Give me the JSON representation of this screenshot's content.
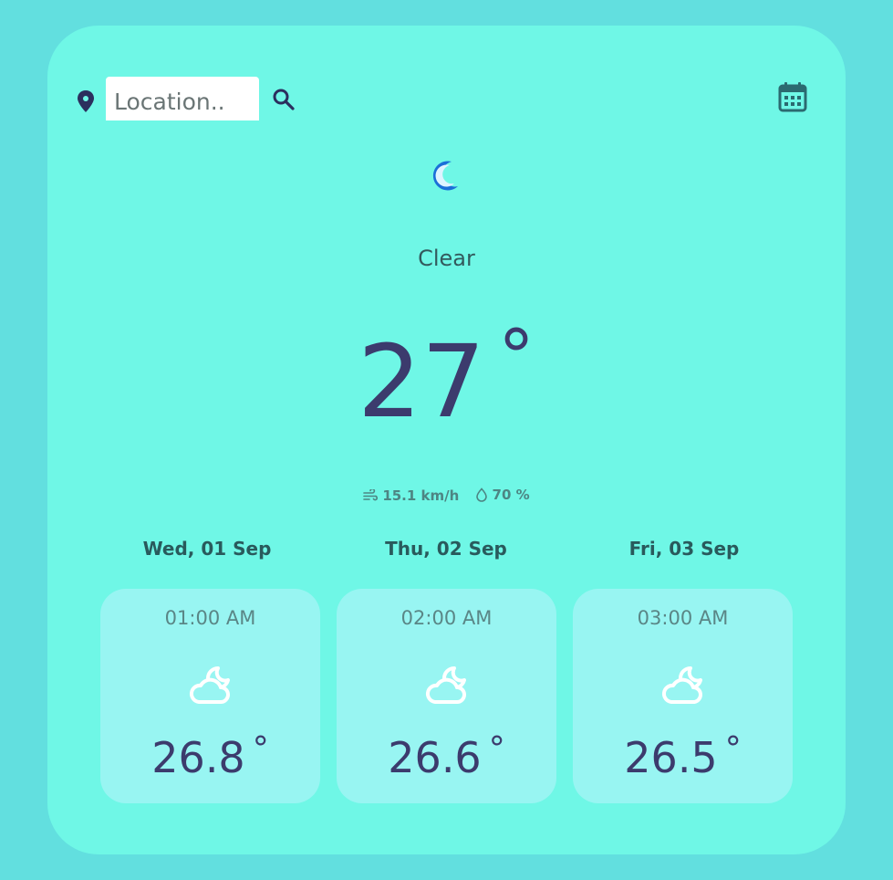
{
  "search": {
    "placeholder": "Location.."
  },
  "current": {
    "condition": "Clear",
    "temperature": "27",
    "degree_symbol": "°",
    "wind": "15.1 km/h",
    "humidity": "70 %"
  },
  "forecast": [
    {
      "day": "Wed, 01 Sep",
      "time": "01:00 AM",
      "temperature": "26.8",
      "icon": "partly-cloudy-night-icon"
    },
    {
      "day": "Thu, 02 Sep",
      "time": "02:00 AM",
      "temperature": "26.6",
      "icon": "partly-cloudy-night-icon"
    },
    {
      "day": "Fri, 03 Sep",
      "time": "03:00 AM",
      "temperature": "26.5",
      "icon": "partly-cloudy-night-icon"
    }
  ],
  "icons": {
    "location": "location-pin-icon",
    "search": "search-icon",
    "calendar": "calendar-icon",
    "current_weather": "moon-icon",
    "wind": "wind-icon",
    "humidity": "droplet-icon"
  },
  "colors": {
    "page_background": "#62dfdf",
    "card_background": "#6ff7e6",
    "forecast_card_background": "#98f5f2",
    "temperature_text": "#3c3b6d",
    "icon_dark": "#2b2f5e",
    "moon_blue": "#1b6fd8"
  }
}
